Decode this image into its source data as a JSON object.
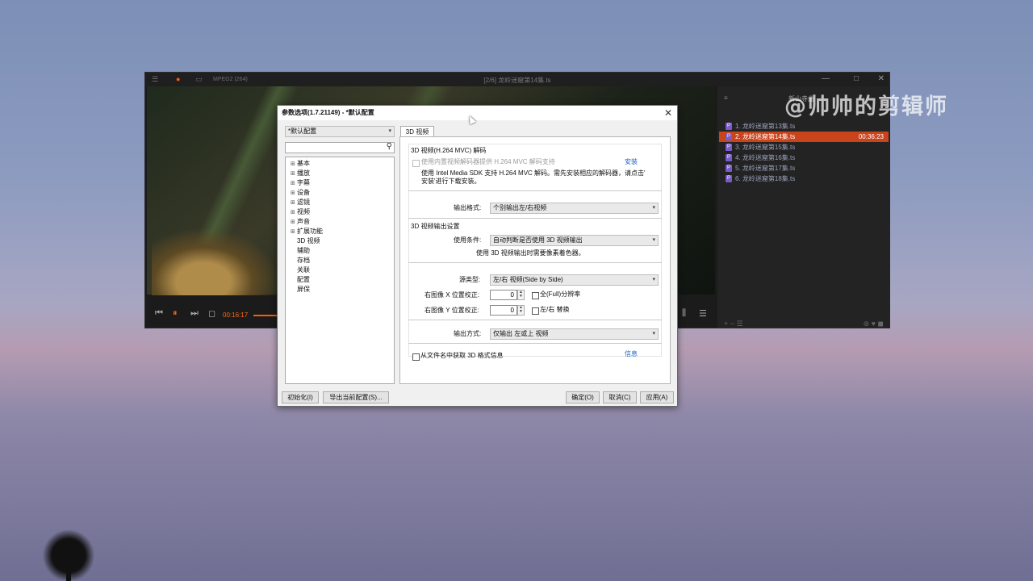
{
  "watermark": "@帅帅的剪辑师",
  "player": {
    "codec": "MPEG2 (264)",
    "title": "[2/6] 龙岭迷窟第14集.ts",
    "time": "00:16:17",
    "window_buttons": [
      "—",
      "□",
      "✕"
    ],
    "icons": [
      "menu-icon",
      "record-icon",
      "monitor-icon"
    ]
  },
  "playlist": {
    "header": "≡",
    "header_right": "新山寺曲",
    "items": [
      {
        "label": "1. 龙岭迷窟第13集.ts",
        "duration": ""
      },
      {
        "label": "2. 龙岭迷窟第14集.ts",
        "duration": "00:36:23"
      },
      {
        "label": "3. 龙岭迷窟第15集.ts",
        "duration": ""
      },
      {
        "label": "4. 龙岭迷窟第16集.ts",
        "duration": ""
      },
      {
        "label": "5. 龙岭迷窟第17集.ts",
        "duration": ""
      },
      {
        "label": "6. 龙岭迷窟第18集.ts",
        "duration": ""
      }
    ],
    "badge": "P",
    "footer_left": "+ − ☰",
    "footer_right": "⊛ ♥ ◼"
  },
  "dialog": {
    "title": "参数选项(1.7.21149) - *默认配置",
    "profile": "*默认配置",
    "tree": [
      "基本",
      "播放",
      "字幕",
      "设备",
      "滤镜",
      "视频",
      "声音",
      "扩展功能",
      "3D 视频",
      "辅助",
      "存档",
      "关联",
      "配置",
      "屏保"
    ],
    "tab": "3D 视频",
    "section1_title": "3D 视频(H.264 MVC) 解码",
    "use_builtin": "使用内置视频解码器提供 H.264 MVC 解码支持",
    "install_link": "安装",
    "intel_note_1": "使用 Intel Media SDK 支持 H.264 MVC 解码。需先安装相应的解码器，请点击'",
    "intel_note_2": "安装'进行下载安装。",
    "output_format_label": "输出格式:",
    "output_format_value": "个别输出左/右视频",
    "section2_title": "3D 视频输出设置",
    "use_condition_label": "使用条件:",
    "use_condition_value": "自动判断是否使用 3D 视频输出",
    "use_condition_note": "使用 3D 视频输出时需要像素着色器。",
    "source_type_label": "源类型:",
    "source_type_value": "左/右 视频(Side by Side)",
    "right_x_label": "右图像 X 位置校正:",
    "right_x_value": "0",
    "right_y_label": "右图像 Y 位置校正:",
    "right_y_value": "0",
    "full_res_label": "全(Full)分辨率",
    "swap_lr_label": "左/右 替换",
    "output_method_label": "输出方式:",
    "output_method_value": "仅输出 左或上 视频",
    "from_filename_label": "从文件名中获取 3D 格式信息",
    "info_link": "信息",
    "buttons": {
      "init": "初始化(I)",
      "export": "导出当前配置(S)...",
      "ok": "确定(O)",
      "cancel": "取消(C)",
      "apply": "应用(A)"
    }
  }
}
